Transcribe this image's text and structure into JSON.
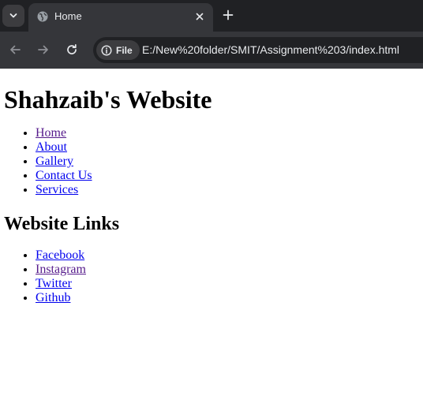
{
  "browser": {
    "tab": {
      "title": "Home"
    },
    "address_bar": {
      "security_chip": "File",
      "url": "E:/New%20folder/SMIT/Assignment%203/index.html"
    }
  },
  "page": {
    "title": "Shahzaib's Website",
    "nav": [
      {
        "label": "Home",
        "visited": true
      },
      {
        "label": "About",
        "visited": false
      },
      {
        "label": "Gallery",
        "visited": false
      },
      {
        "label": "Contact Us",
        "visited": false
      },
      {
        "label": "Services",
        "visited": false
      }
    ],
    "links_heading": "Website Links",
    "links": [
      {
        "label": "Facebook",
        "visited": false
      },
      {
        "label": "Instagram",
        "visited": true
      },
      {
        "label": "Twitter",
        "visited": false
      },
      {
        "label": "Github",
        "visited": false
      }
    ]
  },
  "colors": {
    "tabstrip_bg": "#202124",
    "toolbar_bg": "#35363a",
    "link": "#0000ee",
    "link_visited": "#551a8b"
  },
  "icons": [
    "chevron-down-icon",
    "globe-icon",
    "close-icon",
    "plus-icon",
    "back-arrow-icon",
    "forward-arrow-icon",
    "reload-icon",
    "info-icon"
  ]
}
